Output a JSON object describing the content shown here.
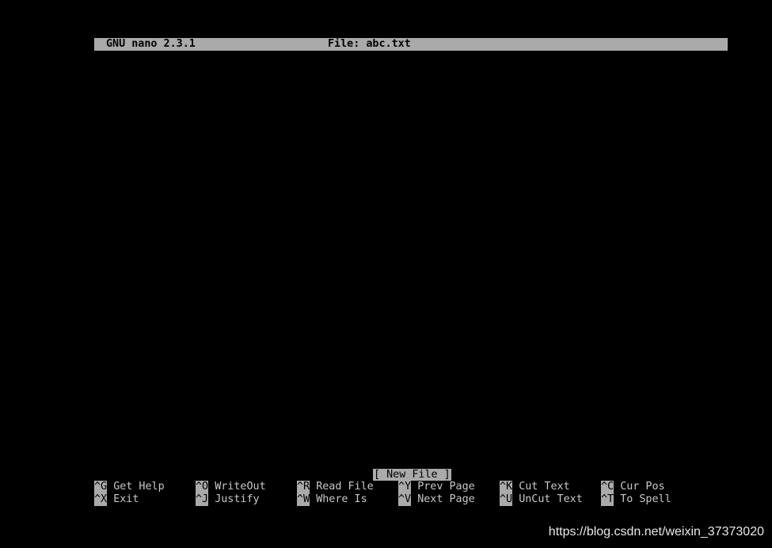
{
  "titlebar": {
    "app": "GNU nano 2.3.1",
    "file": "File: abc.txt"
  },
  "status": "[ New File ]",
  "shortcuts": [
    {
      "key": "^G",
      "label": "Get Help"
    },
    {
      "key": "^O",
      "label": "WriteOut"
    },
    {
      "key": "^R",
      "label": "Read File"
    },
    {
      "key": "^Y",
      "label": "Prev Page"
    },
    {
      "key": "^K",
      "label": "Cut Text"
    },
    {
      "key": "^C",
      "label": "Cur Pos"
    },
    {
      "key": "^X",
      "label": "Exit"
    },
    {
      "key": "^J",
      "label": "Justify"
    },
    {
      "key": "^W",
      "label": "Where Is"
    },
    {
      "key": "^V",
      "label": "Next Page"
    },
    {
      "key": "^U",
      "label": "UnCut Text"
    },
    {
      "key": "^T",
      "label": "To Spell"
    }
  ],
  "watermark": "https://blog.csdn.net/weixin_37373020"
}
